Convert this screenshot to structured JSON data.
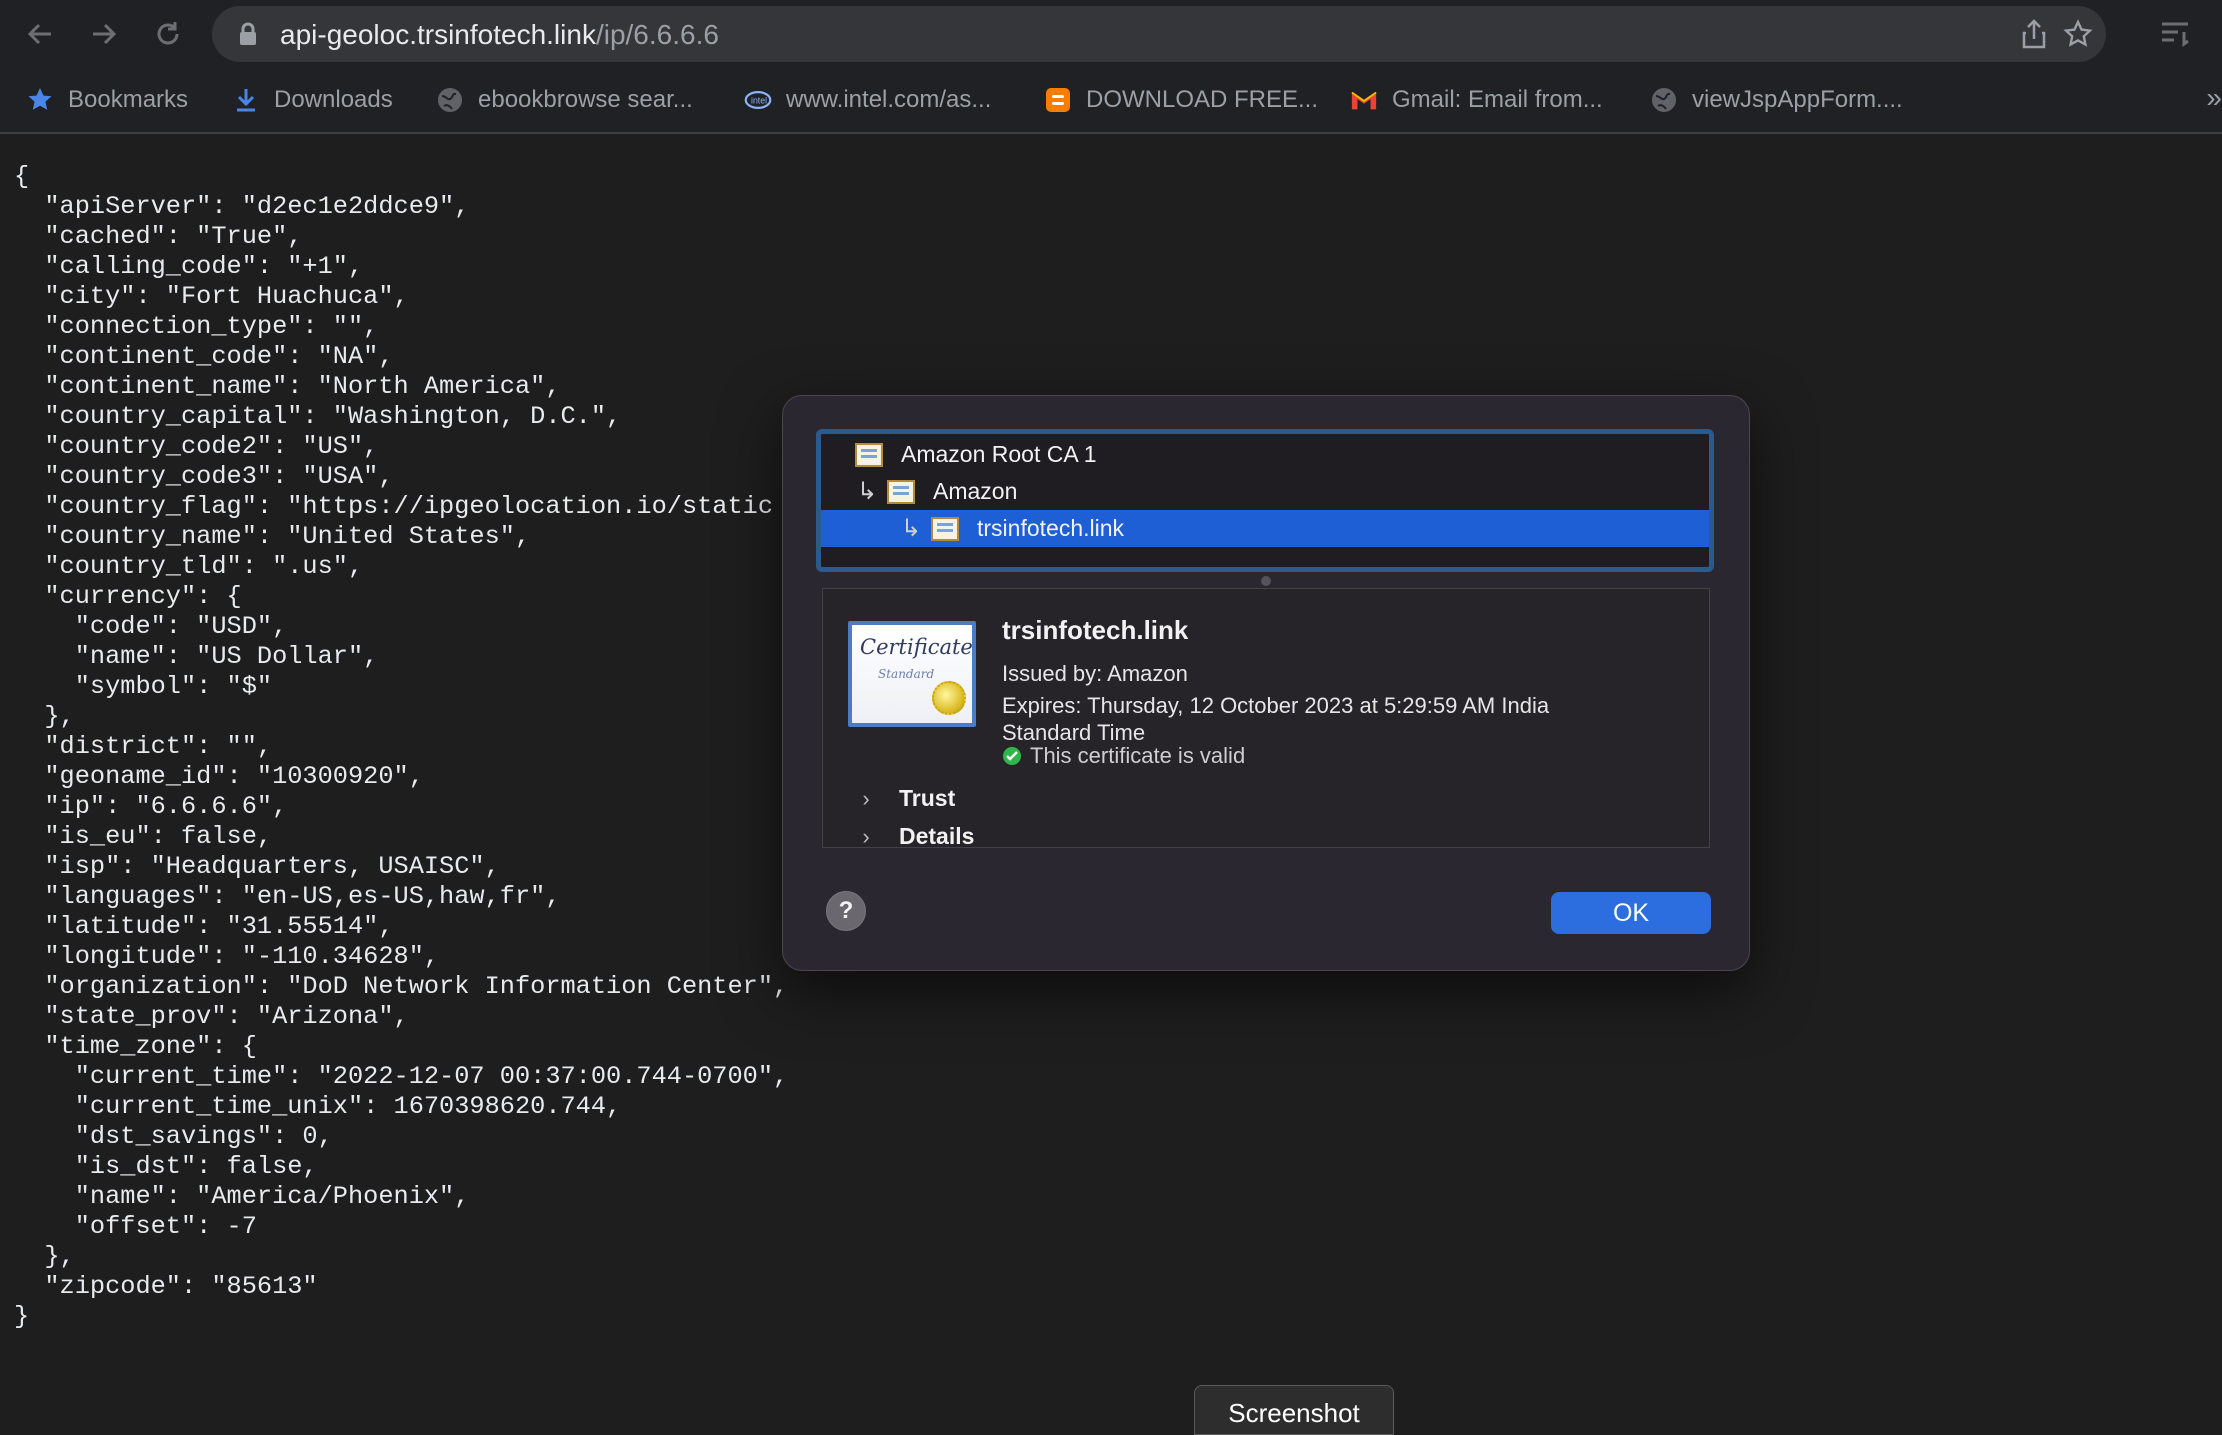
{
  "browser": {
    "url_host": "api-geoloc.trsinfotech.link",
    "url_path": "/ip/6.6.6.6"
  },
  "bookmarks": [
    {
      "label": "Bookmarks",
      "icon": "star-icon"
    },
    {
      "label": "Downloads",
      "icon": "download-icon"
    },
    {
      "label": "ebookbrowse sear...",
      "icon": "globe-icon"
    },
    {
      "label": "www.intel.com/as...",
      "icon": "intel-icon"
    },
    {
      "label": "DOWNLOAD FREE...",
      "icon": "blogger-icon"
    },
    {
      "label": "Gmail: Email from...",
      "icon": "gmail-icon"
    },
    {
      "label": "viewJspAppForm....",
      "icon": "globe-icon"
    }
  ],
  "bookmarks_more": "»",
  "json_lines": [
    "{",
    "  \"apiServer\": \"d2ec1e2ddce9\",",
    "  \"cached\": \"True\",",
    "  \"calling_code\": \"+1\",",
    "  \"city\": \"Fort Huachuca\",",
    "  \"connection_type\": \"\",",
    "  \"continent_code\": \"NA\",",
    "  \"continent_name\": \"North America\",",
    "  \"country_capital\": \"Washington, D.C.\",",
    "  \"country_code2\": \"US\",",
    "  \"country_code3\": \"USA\",",
    "  \"country_flag\": \"https://ipgeolocation.io/static",
    "  \"country_name\": \"United States\",",
    "  \"country_tld\": \".us\",",
    "  \"currency\": {",
    "    \"code\": \"USD\",",
    "    \"name\": \"US Dollar\",",
    "    \"symbol\": \"$\"",
    "  },",
    "  \"district\": \"\",",
    "  \"geoname_id\": \"10300920\",",
    "  \"ip\": \"6.6.6.6\",",
    "  \"is_eu\": false,",
    "  \"isp\": \"Headquarters, USAISC\",",
    "  \"languages\": \"en-US,es-US,haw,fr\",",
    "  \"latitude\": \"31.55514\",",
    "  \"longitude\": \"-110.34628\",",
    "  \"organization\": \"DoD Network Information Center\",",
    "  \"state_prov\": \"Arizona\",",
    "  \"time_zone\": {",
    "    \"current_time\": \"2022-12-07 00:37:00.744-0700\",",
    "    \"current_time_unix\": 1670398620.744,",
    "    \"dst_savings\": 0,",
    "    \"is_dst\": false,",
    "    \"name\": \"America/Phoenix\",",
    "    \"offset\": -7",
    "  },",
    "  \"zipcode\": \"85613\"",
    "}"
  ],
  "dialog": {
    "tree": [
      {
        "label": "Amazon Root CA 1",
        "selected": false
      },
      {
        "label": "Amazon",
        "selected": false
      },
      {
        "label": "trsinfotech.link",
        "selected": true
      }
    ],
    "cert_art_text": "Certificate",
    "cert_art_sub": "Standard",
    "title": "trsinfotech.link",
    "issued_by": "Issued by: Amazon",
    "expires_line1": "Expires: Thursday, 12 October 2023 at 5:29:59 AM India",
    "expires_line2": "Standard Time",
    "valid_text": "This certificate is valid",
    "trust_label": "Trust",
    "details_label": "Details",
    "help_label": "?",
    "ok_label": "OK"
  },
  "screenshot_tip": "Screenshot"
}
